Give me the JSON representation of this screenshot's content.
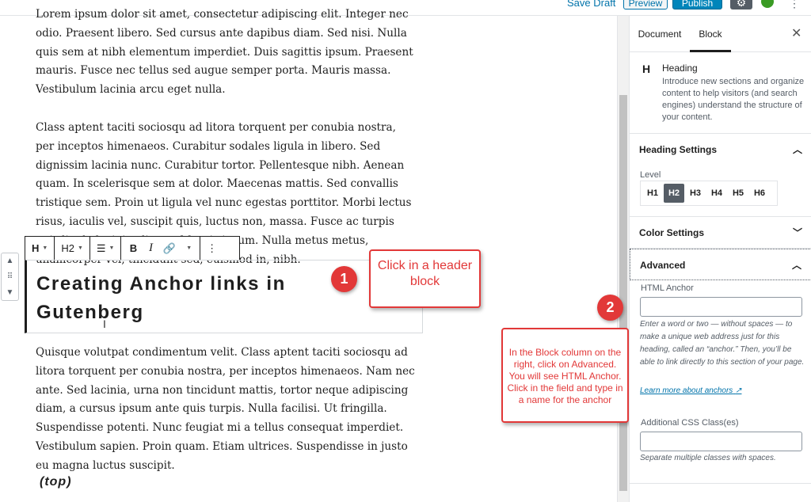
{
  "topbar": {
    "save_draft": "Save Draft",
    "preview": "Preview",
    "publish": "Publish",
    "gear_icon": "gear-icon",
    "jetpack_icon": "jetpack-icon",
    "more_icon": "ellipsis-vertical-icon"
  },
  "editor": {
    "paragraph1": "Lorem ipsum dolor sit amet, consectetur adipiscing elit. Integer nec odio. Praesent libero. Sed cursus ante dapibus diam. Sed nisi. Nulla quis sem at nibh elementum imperdiet. Duis sagittis ipsum. Praesent mauris. Fusce nec tellus sed augue semper porta. Mauris massa. Vestibulum lacinia arcu eget nulla.",
    "paragraph2": "Class aptent taciti sociosqu ad litora torquent per conubia nostra, per inceptos himenaeos. Curabitur sodales ligula in libero. Sed dignissim lacinia nunc. Curabitur tortor. Pellentesque nibh. Aenean quam. In scelerisque sem at dolor. Maecenas mattis. Sed convallis tristique sem. Proin ut ligula vel nunc egestas porttitor. Morbi lectus risus, iaculis vel, suscipit quis, luctus non, massa. Fusce ac turpis quis ligula lacinia aliquet. Mauris ipsum. Nulla metus metus, ullamcorper vel, tincidunt sed, euismod in, nibh.",
    "heading": "Creating Anchor links in Gutenberg",
    "paragraph3": "Quisque volutpat condimentum velit. Class aptent taciti sociosqu ad litora torquent per conubia nostra, per inceptos himenaeos. Nam nec ante. Sed lacinia, urna non tincidunt mattis, tortor neque adipiscing diam, a cursus ipsum ante quis turpis. Nulla facilisi. Ut fringilla. Suspendisse potenti. Nunc feugiat mi a tellus consequat imperdiet. Vestibulum sapien. Proin quam. Etiam ultrices. Suspendisse in justo eu magna luctus suscipit.",
    "top_anchor": "(top)"
  },
  "block_toolbar": {
    "block_type": "H",
    "level": "H2",
    "align_icon": "align-left-icon",
    "bold": "B",
    "italic": "I",
    "link_icon": "link-icon",
    "more_icon": "ellipsis-vertical-icon"
  },
  "mover": {
    "up_icon": "chevron-up-icon",
    "drag_icon": "drag-handle-icon",
    "down_icon": "chevron-down-icon"
  },
  "callouts": {
    "num1": "1",
    "text1": "Click in a header block",
    "num2": "2",
    "text2": "In the Block column on the right, click on Advanced. You will see HTML Anchor. Click in the field and type in a name for the anchor",
    "color": "#e23838"
  },
  "sidebar": {
    "tabs": [
      "Document",
      "Block"
    ],
    "active_tab": "Block",
    "close_icon": "close-icon",
    "block_card": {
      "icon": "H",
      "title": "Heading",
      "description": "Introduce new sections and organize content to help visitors (and search engines) understand the structure of your content."
    },
    "heading_settings": {
      "title": "Heading Settings",
      "level_label": "Level",
      "levels": [
        "H1",
        "H2",
        "H3",
        "H4",
        "H5",
        "H6"
      ],
      "active_level": "H2"
    },
    "color_settings": {
      "title": "Color Settings"
    },
    "advanced": {
      "title": "Advanced",
      "html_anchor_label": "HTML Anchor",
      "html_anchor_value": "",
      "anchor_help": "Enter a word or two — without spaces — to make a unique web address just for this heading, called an “anchor.” Then, you’ll be able to link directly to this section of your page.",
      "learn_more": "Learn more about anchors",
      "css_label": "Additional CSS Class(es)",
      "css_value": "",
      "css_help": "Separate multiple classes with spaces."
    }
  }
}
